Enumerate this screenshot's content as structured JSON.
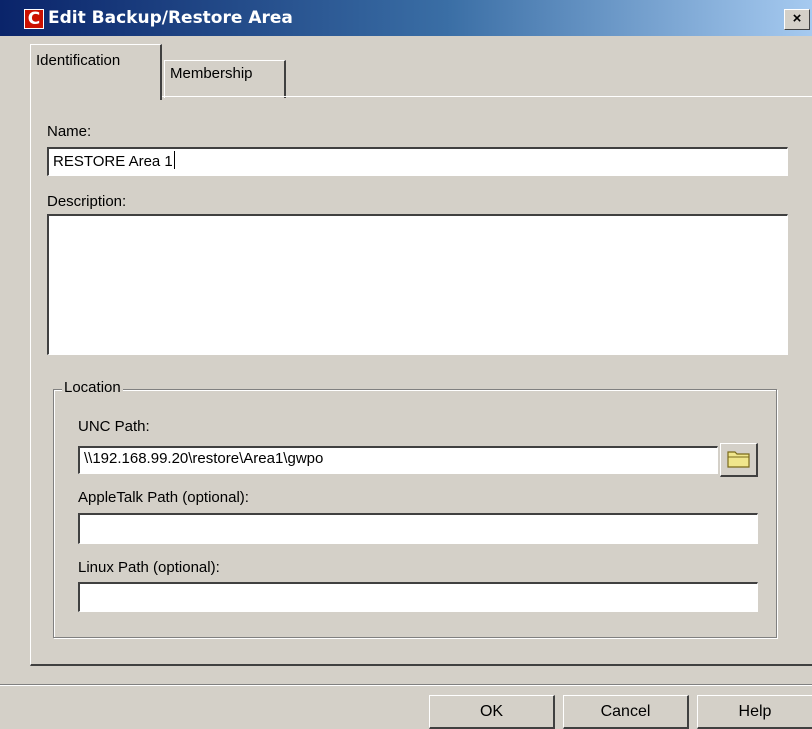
{
  "window": {
    "title": "Edit Backup/Restore Area",
    "app_icon_letter": "C",
    "close_glyph": "×",
    "app_icon": "novell-c-icon"
  },
  "tabs": [
    {
      "label": "Identification",
      "selected": true
    },
    {
      "label": "Membership",
      "selected": false
    }
  ],
  "identification": {
    "name_label": "Name:",
    "name_value": "RESTORE Area 1",
    "description_label": "Description:",
    "description_value": ""
  },
  "location": {
    "legend": "Location",
    "unc_label": "UNC Path:",
    "unc_value": "\\\\192.168.99.20\\restore\\Area1\\gwpo",
    "browse_icon": "folder-icon",
    "appletalk_label": "AppleTalk Path (optional):",
    "appletalk_value": "",
    "linux_label": "Linux Path (optional):",
    "linux_value": ""
  },
  "buttons": {
    "ok": "OK",
    "cancel": "Cancel",
    "help": "Help"
  },
  "colors": {
    "title_bar_start": "#0a246a",
    "title_bar_end": "#a6caf0",
    "face": "#d4d0c8",
    "app_icon": "#cc1100",
    "folder": "#f0e68c"
  }
}
